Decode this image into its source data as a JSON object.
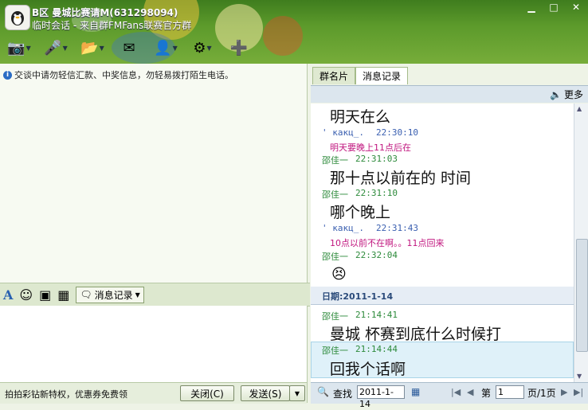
{
  "window": {
    "title": "B区 曼城比赛请M(631298094)",
    "subtitle": "临时会话 - 来自群FMFans联赛官方群",
    "controls": [
      "minimize",
      "maximize",
      "close"
    ]
  },
  "toolbar": {
    "items": [
      {
        "icon": "webcam-icon"
      },
      {
        "icon": "microphone-icon"
      },
      {
        "icon": "folder-icon"
      },
      {
        "icon": "mail-icon"
      },
      {
        "icon": "user-info-icon"
      },
      {
        "icon": "settings-icon"
      },
      {
        "icon": "add-app-icon"
      }
    ]
  },
  "notice": "交谈中请勿轻信汇款、中奖信息，勿轻易拨打陌生电话。",
  "format_bar": {
    "message_record_label": "消息记录"
  },
  "bottom": {
    "promo": "拍拍彩钻新特权，优惠券免费领",
    "close_label": "关闭(C)",
    "send_label": "发送(S)"
  },
  "tabs": [
    {
      "label": "群名片",
      "active": false
    },
    {
      "label": "消息记录",
      "active": true
    }
  ],
  "more_label": "更多",
  "history": {
    "date_label": "日期:2011-1-14",
    "messages": [
      {
        "big": "明天在么"
      },
      {
        "sender": "' каκц_.",
        "time": "22:30:10",
        "text": "明天要晚上11点后在"
      },
      {
        "sender": "邵佳一",
        "time": "22:31:03"
      },
      {
        "big": "那十点以前在的 时间"
      },
      {
        "sender": "邵佳一",
        "time": "22:31:10"
      },
      {
        "big": "哪个晚上"
      },
      {
        "sender": "' каκц_.",
        "time": "22:31:43",
        "text": "10点以前不在啊。。11点回来"
      },
      {
        "sender": "邵佳一",
        "time": "22:32:04",
        "emoji": "😣"
      },
      {
        "sender": "邵佳一",
        "time": "21:14:41",
        "big": "曼城   杯赛到底什么时候打"
      },
      {
        "sender": "邵佳一",
        "time": "21:14:44",
        "big": "回我个话啊"
      }
    ]
  },
  "footer": {
    "search_label": "查找",
    "date_value": "2011-1-14",
    "page_prefix": "第",
    "page_value": "1",
    "page_suffix": "页/1页"
  },
  "colors": {
    "titlebar": "#5c9a2b",
    "sender_green": "#2e8b3c",
    "sender_blue": "#3a5fb0",
    "pink_text": "#c0157e"
  }
}
